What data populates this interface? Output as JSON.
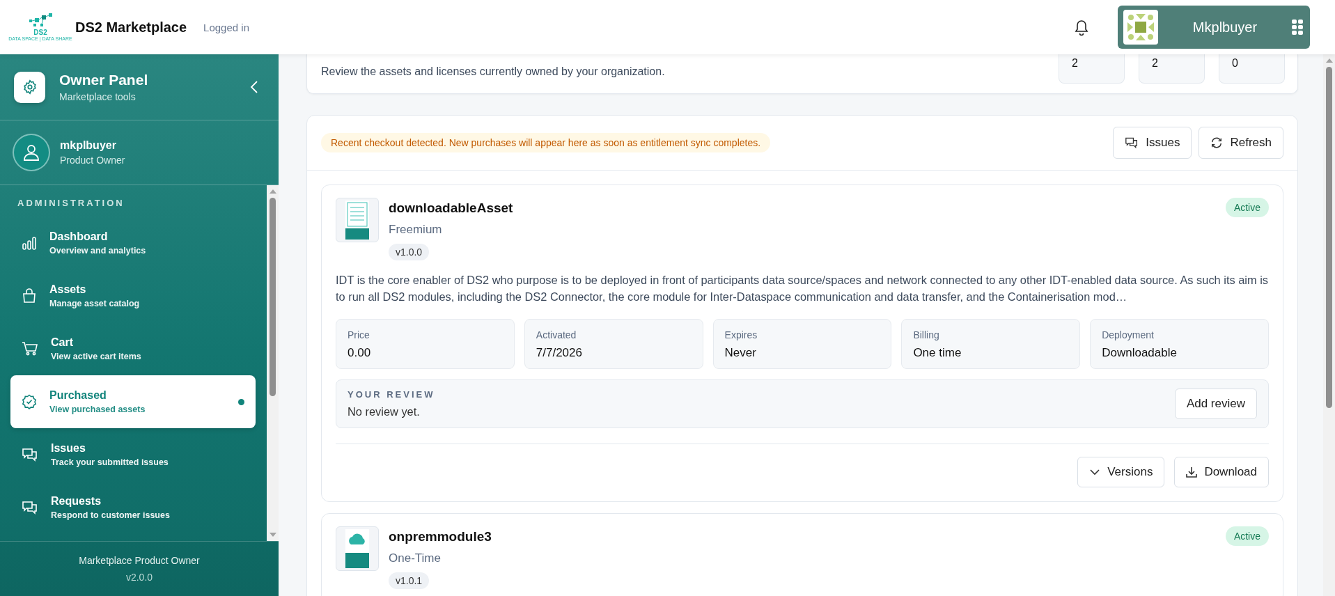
{
  "header": {
    "logo_text": "DS2",
    "logo_tagline": "DATA SPACE | DATA SHARE",
    "title": "DS2 Marketplace",
    "status": "Logged in",
    "user_name": "Mkplbuyer"
  },
  "sidebar": {
    "title": "Owner Panel",
    "subtitle": "Marketplace tools",
    "user": {
      "name": "mkplbuyer",
      "role": "Product Owner"
    },
    "section": "ADMINISTRATION",
    "items": [
      {
        "label": "Dashboard",
        "description": "Overview and analytics",
        "kind": "chart",
        "selected": false
      },
      {
        "label": "Assets",
        "description": "Manage asset catalog",
        "kind": "bag",
        "selected": false
      },
      {
        "label": "Cart",
        "description": "View active cart items",
        "kind": "cart",
        "selected": false
      },
      {
        "label": "Purchased",
        "description": "View purchased assets",
        "kind": "check",
        "selected": true
      },
      {
        "label": "Issues",
        "description": "Track your submitted issues",
        "kind": "chat",
        "selected": false
      },
      {
        "label": "Requests",
        "description": "Respond to customer issues",
        "kind": "chat",
        "selected": false
      }
    ],
    "footer": "Marketplace Product Owner",
    "version": "v2.0.0"
  },
  "summary": {
    "description": "Review the assets and licenses currently owned by your organization.",
    "stats": [
      "2",
      "2",
      "0"
    ]
  },
  "notice": "Recent checkout detected. New purchases will appear here as soon as entitlement sync completes.",
  "toolbar": [
    "Issues",
    "Refresh"
  ],
  "assets": [
    {
      "name": "downloadableAsset",
      "plan": "Freemium",
      "version": "v1.0.0",
      "status": "Active",
      "kind": "document",
      "description": "IDT is the core enabler of DS2 who purpose is to be deployed in front of participants data source/spaces and network connected to any other IDT-enabled data source. As such its aim is to run all DS2 modules, including the DS2 Connector, the core module for Inter-Dataspace communication and data transfer, and the Containerisation mod…",
      "fields": [
        {
          "label": "Price",
          "value": "0.00"
        },
        {
          "label": "Activated",
          "value": "7/7/2026"
        },
        {
          "label": "Expires",
          "value": "Never"
        },
        {
          "label": "Billing",
          "value": "One time"
        },
        {
          "label": "Deployment",
          "value": "Downloadable"
        }
      ],
      "review": {
        "label": "YOUR REVIEW",
        "text": "No review yet.",
        "button": "Add review"
      },
      "actions": [
        "Versions",
        "Download"
      ]
    },
    {
      "name": "onpremmodule3",
      "plan": "One-Time",
      "version": "v1.0.1",
      "status": "Active",
      "kind": "cloud"
    }
  ]
}
